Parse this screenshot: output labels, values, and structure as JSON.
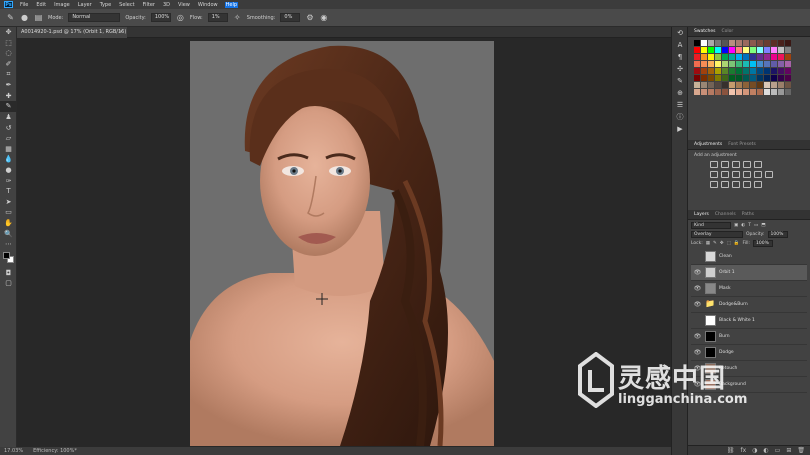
{
  "menu": {
    "items": [
      "File",
      "Edit",
      "Image",
      "Layer",
      "Type",
      "Select",
      "Filter",
      "3D",
      "View",
      "Window",
      "Help"
    ],
    "active_index": 10
  },
  "options": {
    "mode_label": "Mode:",
    "mode_value": "Normal",
    "opacity_label": "Opacity:",
    "opacity_value": "100%",
    "flow_label": "Flow:",
    "flow_value": "1%",
    "smoothing_label": "Smoothing:",
    "smoothing_value": "0%"
  },
  "document": {
    "tab_title": "A0014920-1.psd @ 17% (Orbit 1, RGB/16) *",
    "close_glyph": "×"
  },
  "status": {
    "zoom": "17.03%",
    "efficiency": "Efficiency: 100%*"
  },
  "tools": [
    "move-tool-icon",
    "marquee-tool-icon",
    "lasso-tool-icon",
    "quick-select-tool-icon",
    "crop-tool-icon",
    "eyedropper-tool-icon",
    "healing-tool-icon",
    "brush-tool-icon",
    "stamp-tool-icon",
    "history-brush-tool-icon",
    "eraser-tool-icon",
    "gradient-tool-icon",
    "blur-tool-icon",
    "dodge-tool-icon",
    "pen-tool-icon",
    "type-tool-icon",
    "path-select-tool-icon",
    "shape-tool-icon",
    "hand-tool-icon",
    "zoom-tool-icon"
  ],
  "panels": {
    "swatches_tab": "Swatches",
    "color_tab": "Color",
    "adjustments_tab": "Adjustments",
    "font_presets_tab": "Font Presets",
    "add_adjustment_label": "Add an adjustment",
    "layers_tab": "Layers",
    "channels_tab": "Channels",
    "paths_tab": "Paths",
    "kind_filter": "Kind",
    "blend_mode": "Overlay",
    "opacity_label": "Opacity:",
    "opacity_value": "100%",
    "lock_label": "Lock:",
    "fill_label": "Fill:",
    "fill_value": "100%"
  },
  "layers": [
    {
      "name": "Clean",
      "visible": false,
      "selected": false,
      "thumb": "#d8d8d8"
    },
    {
      "name": "Orbit 1",
      "visible": true,
      "selected": true,
      "thumb": "#cfcfcf"
    },
    {
      "name": "Mask",
      "visible": true,
      "selected": false,
      "thumb": "#888888"
    },
    {
      "name": "Dodge&Burn",
      "visible": true,
      "selected": false,
      "thumb": "folder"
    },
    {
      "name": "Black & White 1",
      "visible": false,
      "selected": false,
      "thumb": "#ffffff"
    },
    {
      "name": "Burn",
      "visible": true,
      "selected": false,
      "thumb": "#000000"
    },
    {
      "name": "Dodge",
      "visible": true,
      "selected": false,
      "thumb": "#000000"
    },
    {
      "name": "Retouch",
      "visible": true,
      "selected": false,
      "thumb": "#8a6a5a"
    },
    {
      "name": "Background",
      "visible": true,
      "selected": false,
      "thumb": "#9a7060"
    }
  ],
  "watermark": {
    "text_cn": "灵感中国",
    "text_url": "lingganchina.com"
  },
  "colors": {
    "accent": "#1473e6",
    "canvas_bg": "#282828",
    "panel_bg": "#424242"
  }
}
